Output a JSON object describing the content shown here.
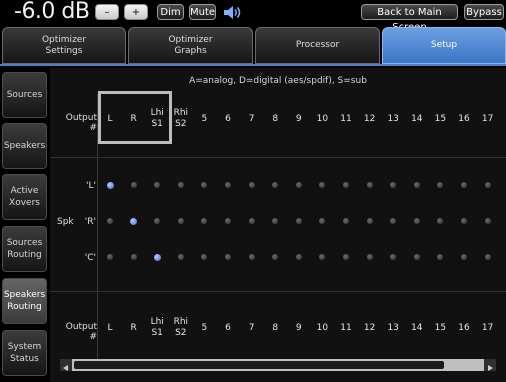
{
  "topbar": {
    "volume": "-6.0 dB",
    "minus": "–",
    "plus": "+",
    "dim": "Dim",
    "mute": "Mute",
    "back": "Back to Main Screen",
    "bypass": "Bypass"
  },
  "tabs": [
    {
      "line1": "Optimizer",
      "line2": "Settings"
    },
    {
      "line1": "Optimizer",
      "line2": "Graphs"
    },
    {
      "line1": "Processor",
      "line2": ""
    },
    {
      "line1": "Setup",
      "line2": ""
    }
  ],
  "sidebar": [
    {
      "line1": "Sources",
      "line2": ""
    },
    {
      "line1": "Speakers",
      "line2": ""
    },
    {
      "line1": "Active",
      "line2": "Xovers"
    },
    {
      "line1": "Sources",
      "line2": "Routing"
    },
    {
      "line1": "Speakers",
      "line2": "Routing"
    },
    {
      "line1": "System",
      "line2": "Status"
    }
  ],
  "main": {
    "legend": "A=analog, D=digital (aes/spdif), S=sub",
    "output_label": "Output #",
    "spk_label": "Spk",
    "rows": [
      "'L'",
      "'R'",
      "'C'"
    ],
    "columns": [
      {
        "l1": "L",
        "l2": ""
      },
      {
        "l1": "R",
        "l2": ""
      },
      {
        "l1": "Lhi",
        "l2": "S1"
      },
      {
        "l1": "Rhi",
        "l2": "S2"
      },
      {
        "l1": "5",
        "l2": ""
      },
      {
        "l1": "6",
        "l2": ""
      },
      {
        "l1": "7",
        "l2": ""
      },
      {
        "l1": "8",
        "l2": ""
      },
      {
        "l1": "9",
        "l2": ""
      },
      {
        "l1": "10",
        "l2": ""
      },
      {
        "l1": "11",
        "l2": ""
      },
      {
        "l1": "12",
        "l2": ""
      },
      {
        "l1": "13",
        "l2": ""
      },
      {
        "l1": "14",
        "l2": ""
      },
      {
        "l1": "15",
        "l2": ""
      },
      {
        "l1": "16",
        "l2": ""
      },
      {
        "l1": "17",
        "l2": ""
      }
    ],
    "active": [
      [
        0,
        0
      ],
      [
        1,
        1
      ],
      [
        2,
        2
      ]
    ]
  },
  "colors": {
    "accent": "#4a7fcb",
    "active_dot": "#3d64d6"
  }
}
